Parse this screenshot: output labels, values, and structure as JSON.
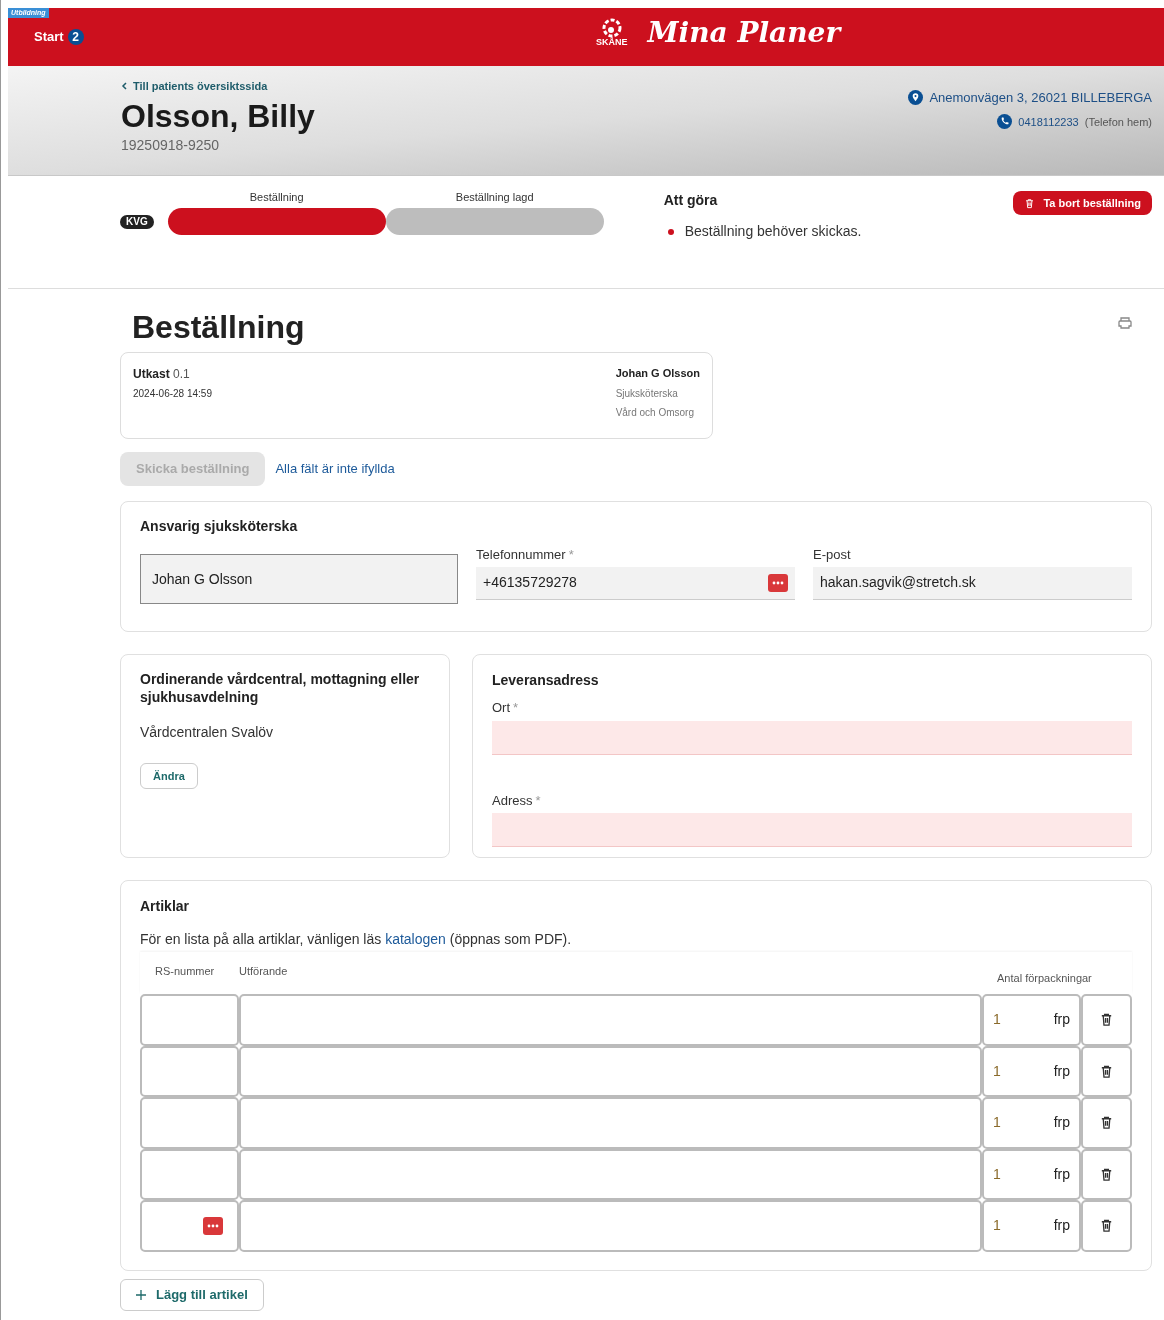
{
  "header": {
    "env_tag": "Utbildning",
    "start_label": "Start",
    "start_count": "2",
    "logo_text": "SKÅNE",
    "app_title": "Mina Planer"
  },
  "patient": {
    "back_link": "Till patients översiktssida",
    "name": "Olsson, Billy",
    "id": "19250918-9250",
    "address": "Anemonvägen 3, 26021 BILLEBERGA",
    "phone": "0418112233",
    "phone_type": "(Telefon hem)"
  },
  "progress": {
    "badge": "KVG",
    "steps": [
      {
        "label": "Beställning",
        "done": true
      },
      {
        "label": "Beställning lagd",
        "done": false
      }
    ]
  },
  "todo": {
    "title": "Att göra",
    "items": [
      "Beställning behöver skickas."
    ]
  },
  "delete_button": "Ta bort beställning",
  "order": {
    "title": "Beställning",
    "draft_label": "Utkast",
    "draft_version": "0.1",
    "date": "2024-06-28 14:59",
    "author": "Johan G Olsson",
    "role": "Sjuksköterska",
    "unit": "Vård och Omsorg"
  },
  "send_button": {
    "label": "Skicka beställning",
    "disabled": true
  },
  "incomplete_link": "Alla fält är inte ifyllda",
  "nurse": {
    "title": "Ansvarig sjuksköterska",
    "name": "Johan G Olsson",
    "fields": [
      {
        "label": "Telefonnummer",
        "required_mark": "*",
        "value": "+46135729278",
        "menu_icon": true
      },
      {
        "label": "E-post",
        "value": "hakan.sagvik@stretch.sk",
        "menu_icon": false
      }
    ]
  },
  "clinic": {
    "title": "Ordinerande vårdcentral, mottagning eller sjukhusavdelning",
    "value": "Vårdcentralen Svalöv",
    "change_button": "Ändra"
  },
  "delivery": {
    "title": "Leveransadress",
    "fields": [
      {
        "label": "Ort",
        "required_mark": "*",
        "invalid": true
      },
      {
        "label": "Adress",
        "required_mark": "*",
        "invalid": true
      }
    ]
  },
  "articles": {
    "title": "Artiklar",
    "intro_before": "För en lista på alla artiklar, vänligen läs",
    "intro_link": "katalogen",
    "intro_after": "(öppnas som PDF).",
    "columns": [
      "RS-nummer",
      "Utförande",
      "Antal förpackningar"
    ],
    "rows": [
      {
        "quantity": "1",
        "unit": "frp",
        "menu_icon": false
      },
      {
        "quantity": "1",
        "unit": "frp",
        "menu_icon": false
      },
      {
        "quantity": "1",
        "unit": "frp",
        "menu_icon": false
      },
      {
        "quantity": "1",
        "unit": "frp",
        "menu_icon": false
      },
      {
        "quantity": "1",
        "unit": "frp",
        "menu_icon": true
      }
    ],
    "add_button": "Lägg till artikel"
  }
}
